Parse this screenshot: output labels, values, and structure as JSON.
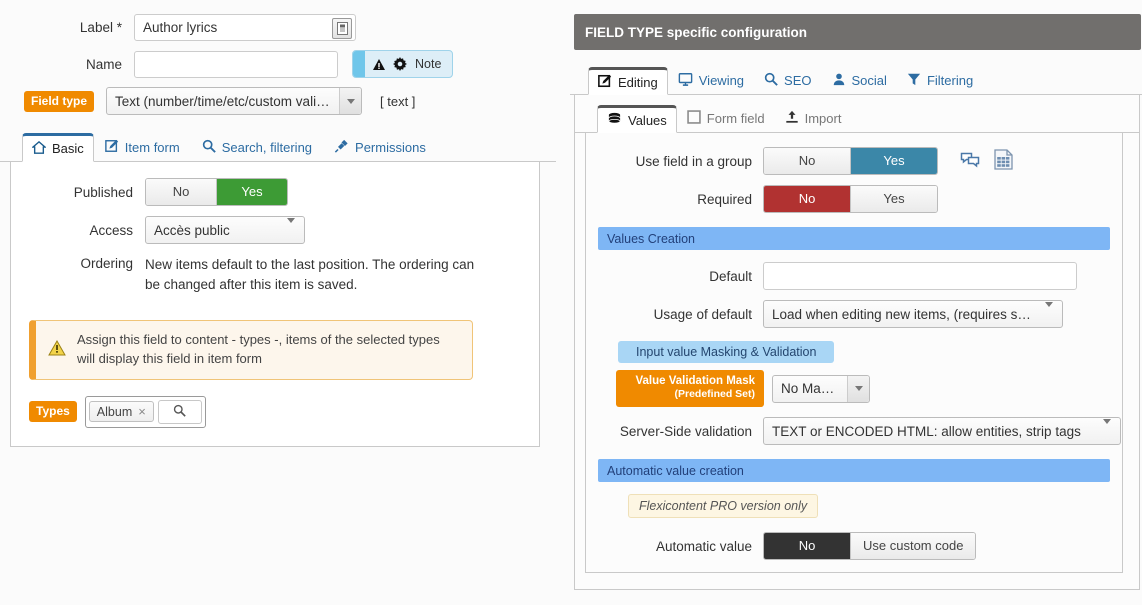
{
  "left": {
    "label_row": {
      "label": "Label",
      "required_mark": "*",
      "value": "Author lyrics",
      "icon": "picker-icon"
    },
    "name_row": {
      "label": "Name",
      "value": "",
      "placeholder": ""
    },
    "note_button": {
      "text": "Note",
      "warn_icon": "warning-icon",
      "gear_icon": "gear-icon"
    },
    "field_type": {
      "tag": "Field type",
      "value": "Text (number/time/etc/custom validation)",
      "hint": "[ text ]"
    },
    "tabs": [
      {
        "label": "Basic",
        "icon": "home-icon",
        "active": true
      },
      {
        "label": "Item form",
        "icon": "edit-icon",
        "active": false
      },
      {
        "label": "Search, filtering",
        "icon": "search-icon",
        "active": false
      },
      {
        "label": "Permissions",
        "icon": "plug-icon",
        "active": false
      }
    ],
    "published": {
      "label": "Published",
      "options": [
        "No",
        "Yes"
      ],
      "selected": "Yes"
    },
    "access": {
      "label": "Access",
      "value": "Accès public"
    },
    "ordering": {
      "label": "Ordering",
      "text": "New items default to the last position. The ordering can be changed after this item is saved."
    },
    "warning": {
      "icon": "warning-icon",
      "text": "Assign this field to content - types -, items of the selected types will display this field in item form"
    },
    "types": {
      "tag": "Types",
      "chips": [
        "Album"
      ],
      "chip_remove": "×",
      "search_icon": "search-icon"
    }
  },
  "right": {
    "header": "FIELD TYPE specific configuration",
    "tabs": [
      {
        "label": "Editing",
        "icon": "edit-icon",
        "active": true
      },
      {
        "label": "Viewing",
        "icon": "monitor-icon",
        "active": false
      },
      {
        "label": "SEO",
        "icon": "search-icon",
        "active": false
      },
      {
        "label": "Social",
        "icon": "user-icon",
        "active": false
      },
      {
        "label": "Filtering",
        "icon": "funnel-icon",
        "active": false
      }
    ],
    "subtabs": [
      {
        "label": "Values",
        "icon": "database-icon",
        "active": true
      },
      {
        "label": "Form field",
        "icon": "checkbox-icon",
        "active": false
      },
      {
        "label": "Import",
        "icon": "upload-icon",
        "active": false
      }
    ],
    "use_field_group": {
      "label": "Use field in a group",
      "options": [
        "No",
        "Yes"
      ],
      "selected": "Yes",
      "icons": [
        "comments-icon",
        "table-icon"
      ]
    },
    "required": {
      "label": "Required",
      "options": [
        "No",
        "Yes"
      ],
      "selected": "No"
    },
    "values_creation_title": "Values Creation",
    "default": {
      "label": "Default",
      "value": "",
      "placeholder": ""
    },
    "usage_of_default": {
      "label": "Usage of default",
      "value": "Load when editing new items, (requires saving)"
    },
    "masking_subtitle": "Input value Masking & Validation",
    "validation_mask": {
      "tag_line1": "Value Validation Mask",
      "tag_line2": "(Predefined Set)",
      "value": "No Masking"
    },
    "server_validation": {
      "label": "Server-Side validation",
      "value": "TEXT or ENCODED HTML: allow entities, strip tags"
    },
    "automatic_title": "Automatic value creation",
    "pro_note": "Flexicontent PRO version only",
    "automatic_value": {
      "label": "Automatic value",
      "options": [
        "No",
        "Use custom code"
      ],
      "selected": "No"
    }
  },
  "colors": {
    "orange": "#f08a00",
    "green": "#3d9b35",
    "blue": "#3b87a8",
    "red": "#b13231",
    "dark": "#333333",
    "section_blue": "#7eb6f5",
    "sub_blue": "#a9d6f5",
    "header_gray": "#716f6d",
    "link_blue": "#2d6ca2"
  }
}
